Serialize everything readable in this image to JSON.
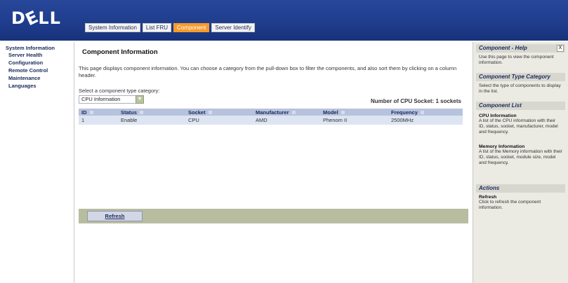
{
  "header": {
    "logo": "D",
    "logo_e": "E",
    "logo_rest": "LL",
    "tabs": [
      {
        "label": "System Information",
        "active": false
      },
      {
        "label": "List FRU",
        "active": false
      },
      {
        "label": "Component",
        "active": true
      },
      {
        "label": "Server Identify",
        "active": false
      }
    ]
  },
  "nav": {
    "items": [
      "System Information",
      "Server Health",
      "Configuration",
      "Remote Control",
      "Maintenance",
      "Languages"
    ]
  },
  "main": {
    "title": "Component Information",
    "description": "This page displays component information. You can choose a category from the pull-down box to filter the components, and also sort them by clicking on a column header.",
    "select_label": "Select a component type category:",
    "select_value": "CPU Information",
    "socket_count": "Number of CPU Socket: 1 sockets",
    "table": {
      "headers": [
        "ID",
        "Status",
        "Socket",
        "Manufacturer",
        "Model",
        "Frequency"
      ],
      "rows": [
        [
          "1",
          "Enable",
          "CPU",
          "AMD",
          "Phenom II",
          "2500MHz"
        ]
      ]
    },
    "refresh_label": "Refresh"
  },
  "help": {
    "title": "Component - Help",
    "close": "X",
    "intro": "Use this page to view the component information.",
    "type_category_title": "Component Type Category",
    "type_category_text": "Select the type of components to display in the list.",
    "list_title": "Component List",
    "cpu_title": "CPU Information",
    "cpu_text": "A list of the CPU information with their ID, status, socket, manufacturer, model and frequency.",
    "mem_title": "Memory Information",
    "mem_text": "A list of the Memory information with their ID, status, socket, module size, model and frequency.",
    "actions_title": "Actions",
    "refresh_title": "Refresh",
    "refresh_text": "Click to refresh the component information."
  },
  "colors": {
    "header_blue": "#1f3c8c",
    "active_tab": "#f59b2c",
    "table_header": "#b7c2dd",
    "table_row": "#dde4f2",
    "help_bg": "#ebeae3"
  }
}
